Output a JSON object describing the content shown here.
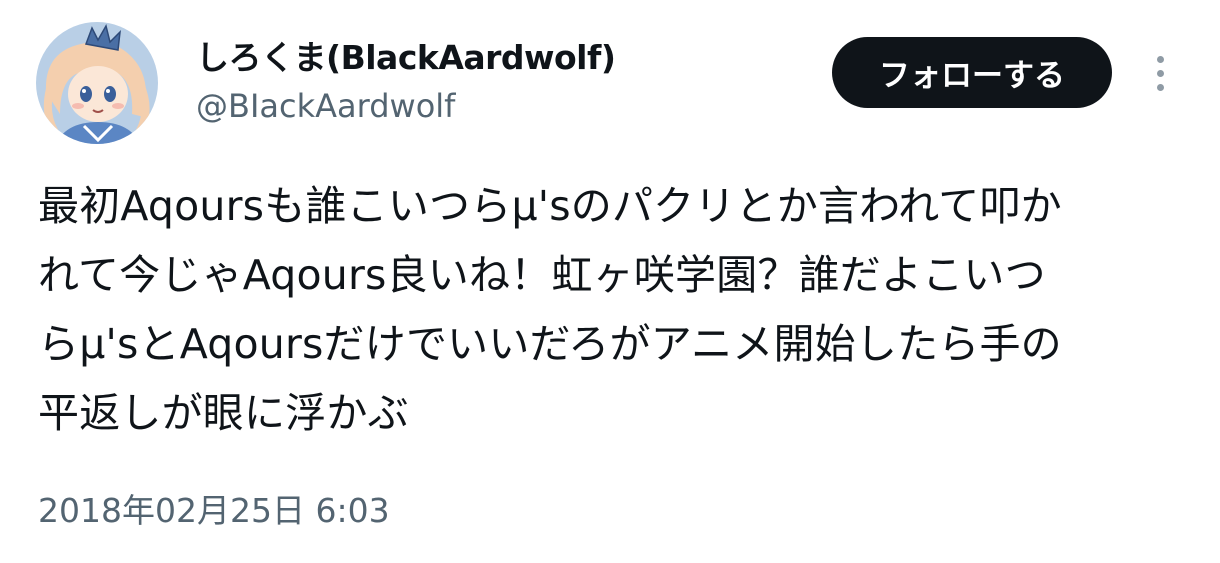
{
  "author": {
    "display_name": "しろくま(BlackAardwolf)",
    "handle": "@BIackAardwolf",
    "avatar_icon": "avatar-illustration"
  },
  "actions": {
    "follow_label": "フォローする",
    "more_icon": "more-vertical-icon"
  },
  "tweet": {
    "text": "最初Aqoursも誰こいつらμ'sのパクリとか言われて叩か\nれて今じゃAqours良いね！虹ヶ咲学園？誰だよこいつ\nらμ'sとAqoursだけでいいだろがアニメ開始したら手の\n平返しが眼に浮かぶ",
    "timestamp": "2018年02月25日 6:03"
  },
  "colors": {
    "text_primary": "#0f1419",
    "text_secondary": "#536471",
    "follow_bg": "#0f1419",
    "follow_text": "#ffffff",
    "avatar_bg": "#b9cfe6"
  }
}
